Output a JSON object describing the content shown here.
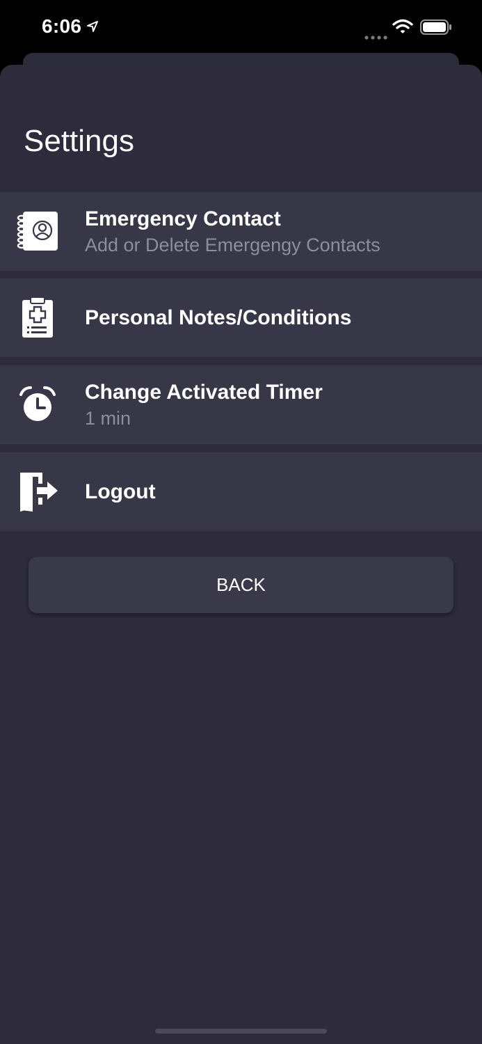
{
  "status_bar": {
    "time": "6:06",
    "icons": [
      "location-arrow-icon",
      "signal-dots-icon",
      "wifi-icon",
      "battery-icon"
    ]
  },
  "page": {
    "title": "Settings"
  },
  "items": [
    {
      "title": "Emergency Contact",
      "subtitle": "Add or Delete Emergengy Contacts",
      "icon": "contact-book-icon"
    },
    {
      "title": "Personal Notes/Conditions",
      "subtitle": "",
      "icon": "medical-clipboard-icon"
    },
    {
      "title": "Change Activated Timer",
      "subtitle": "1 min",
      "icon": "alarm-clock-icon"
    },
    {
      "title": "Logout",
      "subtitle": "",
      "icon": "logout-door-icon"
    }
  ],
  "back_button": {
    "label": "BACK"
  },
  "colors": {
    "background": "#2d2b3c",
    "row": "#383748",
    "text": "#ffffff",
    "subtext": "#8e8d99"
  }
}
